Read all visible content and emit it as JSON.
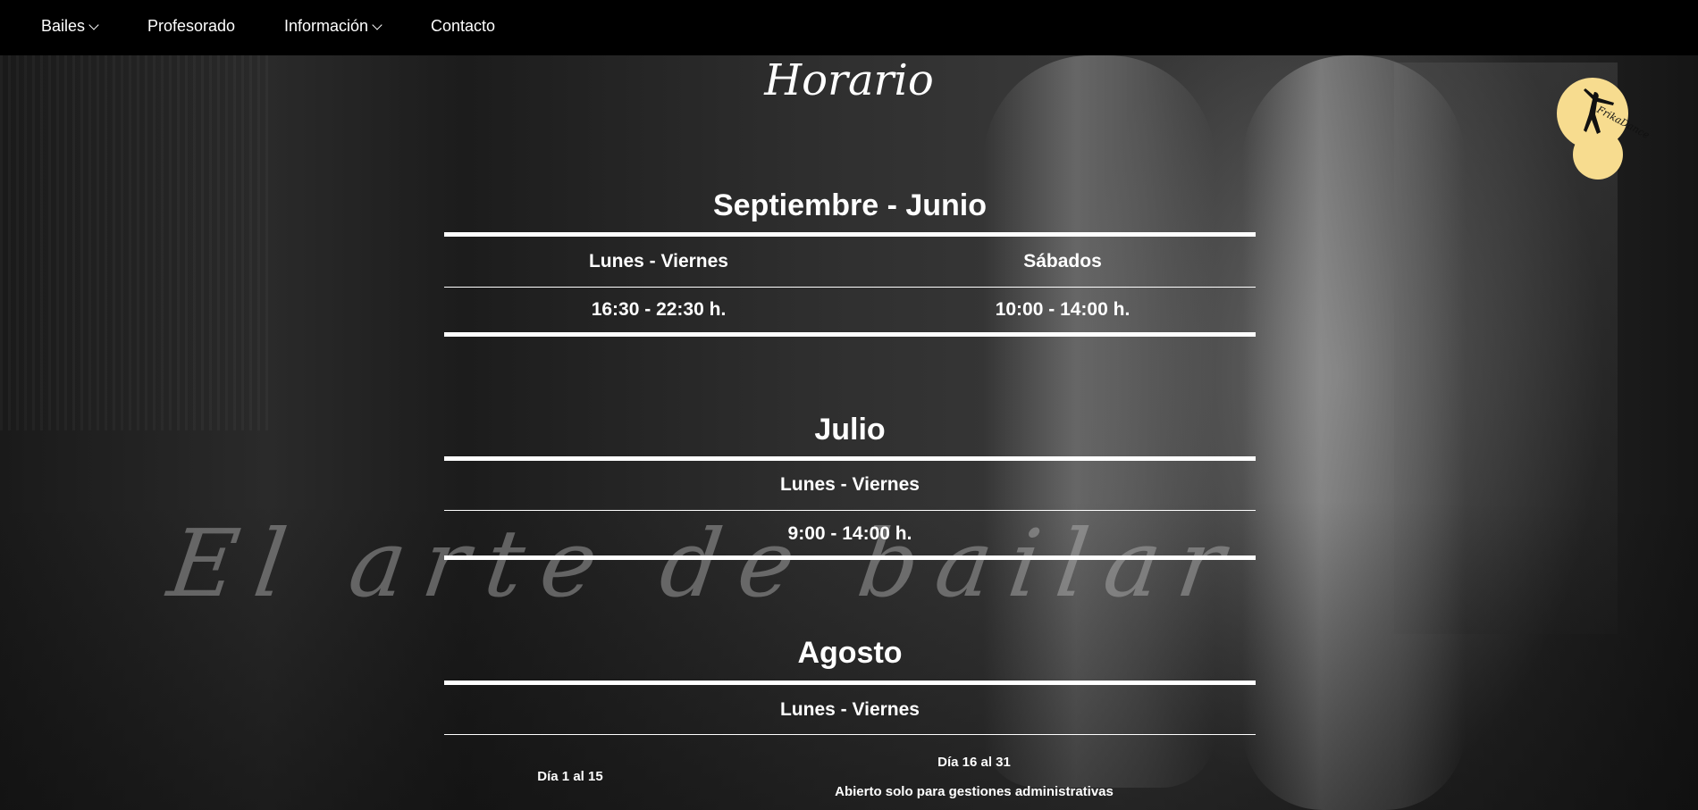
{
  "nav": {
    "items": [
      {
        "label": "Bailes",
        "dropdown": true
      },
      {
        "label": "Profesorado",
        "dropdown": false
      },
      {
        "label": "Información",
        "dropdown": true
      },
      {
        "label": "Contacto",
        "dropdown": false
      }
    ]
  },
  "logo": {
    "text": "FrikaDance",
    "icon": "dancer-logo-icon",
    "color": "#f7dc8f"
  },
  "page": {
    "title": "Horario"
  },
  "watermark": "El arte de bailar",
  "schedules": {
    "sept_june": {
      "title": "Septiembre - Junio",
      "headers": [
        "Lunes - Viernes",
        "Sábados"
      ],
      "values": [
        "16:30 - 22:30 h.",
        "10:00 - 14:00 h."
      ]
    },
    "july": {
      "title": "Julio",
      "header": "Lunes - Viernes",
      "value": "9:00 - 14:00 h."
    },
    "august": {
      "title": "Agosto",
      "header": "Lunes - Viernes",
      "col1": "Día 1 al 15",
      "col2": "Día 16 al 31",
      "note": "Abierto solo para gestiones administrativas"
    }
  }
}
